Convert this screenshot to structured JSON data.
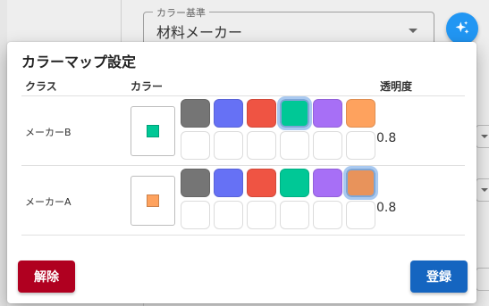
{
  "background": {
    "select_legend": "カラー基準",
    "select_value": "材料メーカー",
    "fab_icon": "sparkle-icon"
  },
  "dialog": {
    "title": "カラーマップ設定",
    "columns": {
      "class": "クラス",
      "color": "カラー",
      "opacity": "透明度"
    },
    "rows": [
      {
        "class_name": "メーカーB",
        "selected_color": "#00c896",
        "palette": [
          "#757575",
          "#6671f5",
          "#ef5443",
          "#00c896",
          "#a76ff6",
          "#fea25e"
        ],
        "selected_index": 3,
        "opacity": "0.8"
      },
      {
        "class_name": "メーカーA",
        "selected_color": "#fea25e",
        "palette": [
          "#757575",
          "#6671f5",
          "#ef5443",
          "#00c896",
          "#a76ff6",
          "#e8935b"
        ],
        "selected_index": 5,
        "opacity": "0.8"
      }
    ],
    "release_label": "解除",
    "register_label": "登録"
  },
  "colors": {
    "release": "#b00020",
    "register": "#1565c0",
    "fab": "#2196f3"
  }
}
